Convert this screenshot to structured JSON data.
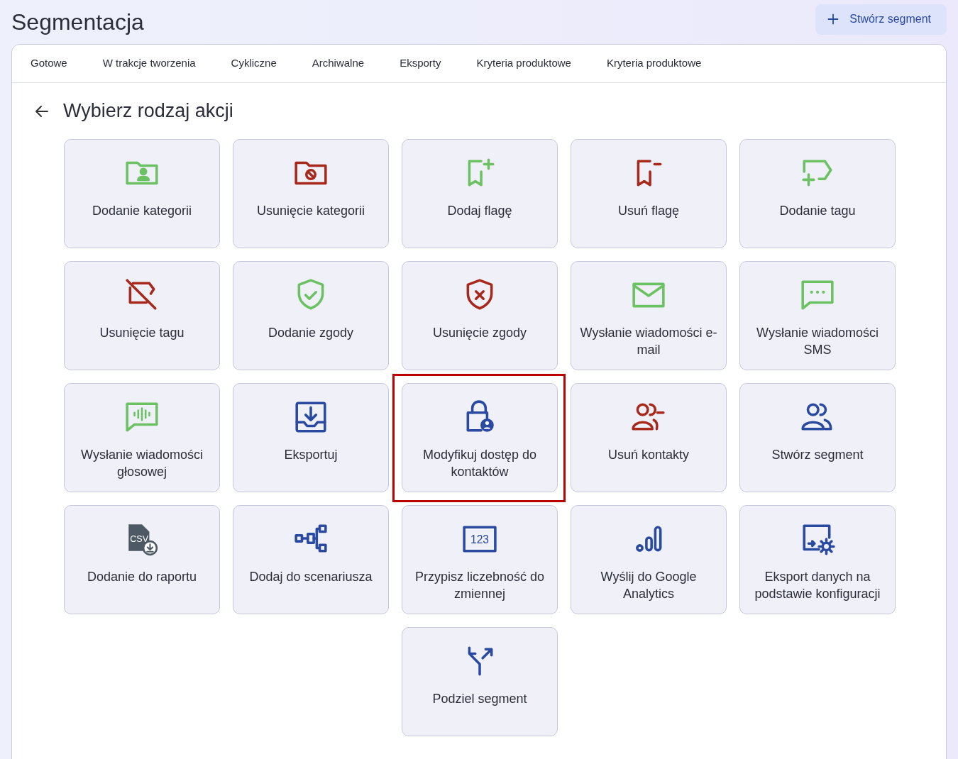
{
  "page_title": "Segmentacja",
  "create_button": {
    "label": "Stwórz segment"
  },
  "tabs": [
    {
      "label": "Gotowe",
      "selected": false
    },
    {
      "label": "W trakcje tworzenia",
      "selected": false
    },
    {
      "label": "Cykliczne",
      "selected": false
    },
    {
      "label": "Archiwalne",
      "selected": false
    },
    {
      "label": "Eksporty",
      "selected": false
    },
    {
      "label": "Kryteria produktowe",
      "selected": false
    },
    {
      "label": "Kryteria produktowe",
      "selected": false
    }
  ],
  "section_title": "Wybierz rodzaj akcji",
  "actions": [
    {
      "label": "Dodanie kategorii",
      "kind": "folder-person",
      "color": "#6cc163",
      "selected": false
    },
    {
      "label": "Usunięcie kategorii",
      "kind": "folder-ban",
      "color": "#a8291c",
      "selected": false
    },
    {
      "label": "Dodaj flagę",
      "kind": "flag-plus",
      "color": "#6cc163",
      "selected": false
    },
    {
      "label": "Usuń flagę",
      "kind": "flag-minus",
      "color": "#a8291c",
      "selected": false
    },
    {
      "label": "Dodanie tagu",
      "kind": "tag-plus",
      "color": "#6cc163",
      "selected": false
    },
    {
      "label": "Usunięcie tagu",
      "kind": "tag-off",
      "color": "#a8291c",
      "selected": false
    },
    {
      "label": "Dodanie zgody",
      "kind": "shield-check",
      "color": "#6cc163",
      "selected": false
    },
    {
      "label": "Usunięcie zgody",
      "kind": "shield-x",
      "color": "#a8291c",
      "selected": false
    },
    {
      "label": "Wysłanie wiadomości e-mail",
      "kind": "envelope",
      "color": "#6cc163",
      "selected": false
    },
    {
      "label": "Wysłanie wiadomości SMS",
      "kind": "chat-dots",
      "color": "#6cc163",
      "selected": false
    },
    {
      "label": "Wysłanie wiadomości głosowej",
      "kind": "chat-wave",
      "color": "#6cc163",
      "selected": false
    },
    {
      "label": "Eksportuj",
      "kind": "tray-download",
      "color": "#2a4aa0",
      "selected": false
    },
    {
      "label": "Modyfikuj dostęp do kontaktów",
      "kind": "lock-person",
      "color": "#2a4aa0",
      "selected": true
    },
    {
      "label": "Usuń kontakty",
      "kind": "people-minus",
      "color": "#a8291c",
      "selected": false
    },
    {
      "label": "Stwórz segment",
      "kind": "people",
      "color": "#2a4aa0",
      "selected": false
    },
    {
      "label": "Dodanie do raportu",
      "kind": "csv-file",
      "color": "#4d5a66",
      "icon_text": "CSV",
      "selected": false
    },
    {
      "label": "Dodaj do scenariusza",
      "kind": "flow",
      "color": "#2a4aa0",
      "selected": false
    },
    {
      "label": "Przypisz liczebność do zmiennej",
      "kind": "number-box",
      "color": "#2a4aa0",
      "icon_text": "123",
      "selected": false
    },
    {
      "label": "Wyślij do Google Analytics",
      "kind": "bars",
      "color": "#2a4aa0",
      "selected": false
    },
    {
      "label": "Eksport danych na podstawie konfiguracji",
      "kind": "screen-gear",
      "color": "#2a4aa0",
      "selected": false
    },
    {
      "label": "Podziel segment",
      "kind": "split-arrows",
      "color": "#2a4aa0",
      "selected": false
    }
  ]
}
